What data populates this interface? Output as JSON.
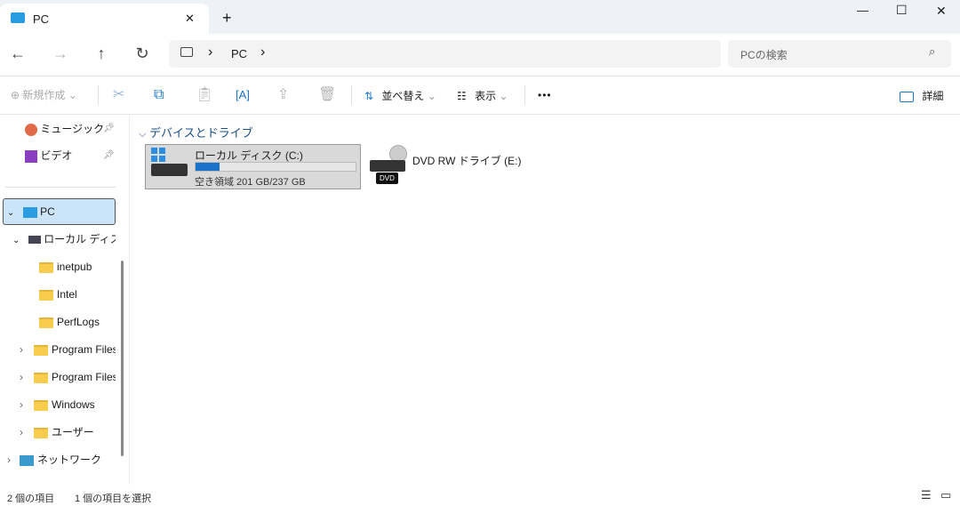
{
  "window": {
    "tab_title": "PC",
    "new_tab": "+",
    "minimize": "—",
    "maximize": "☐",
    "close": "✕",
    "tab_close": "✕"
  },
  "nav": {
    "back": "←",
    "forward": "→",
    "up": "↑",
    "refresh": "↻",
    "breadcrumb": [
      "PC"
    ],
    "search_placeholder": "PCの検索"
  },
  "toolbar": {
    "new": "新規作成",
    "sort": "並べ替え",
    "view": "表示",
    "more": "•••",
    "details": "詳細"
  },
  "sidebar": {
    "items": [
      {
        "label": "ミュージック",
        "pinned": true
      },
      {
        "label": "ビデオ",
        "pinned": true
      },
      {
        "label": "PC",
        "selected": true
      },
      {
        "label": "ローカル ディスク"
      },
      {
        "label": "inetpub"
      },
      {
        "label": "Intel"
      },
      {
        "label": "PerfLogs"
      },
      {
        "label": "Program Files"
      },
      {
        "label": "Program Files"
      },
      {
        "label": "Windows"
      },
      {
        "label": "ユーザー"
      },
      {
        "label": "ネットワーク"
      }
    ]
  },
  "content": {
    "group": "デバイスとドライブ",
    "drives": [
      {
        "name": "ローカル ディスク (C:)",
        "free": "空き領域 201 GB/237 GB",
        "used_fraction": 0.15
      },
      {
        "name": "DVD RW ドライブ (E:)",
        "badge": "DVD"
      }
    ]
  },
  "status": {
    "count": "2 個の項目",
    "selected": "1 個の項目を選択"
  },
  "colors": {
    "accent": "#1a73c8",
    "selection": "#cce4f7"
  }
}
